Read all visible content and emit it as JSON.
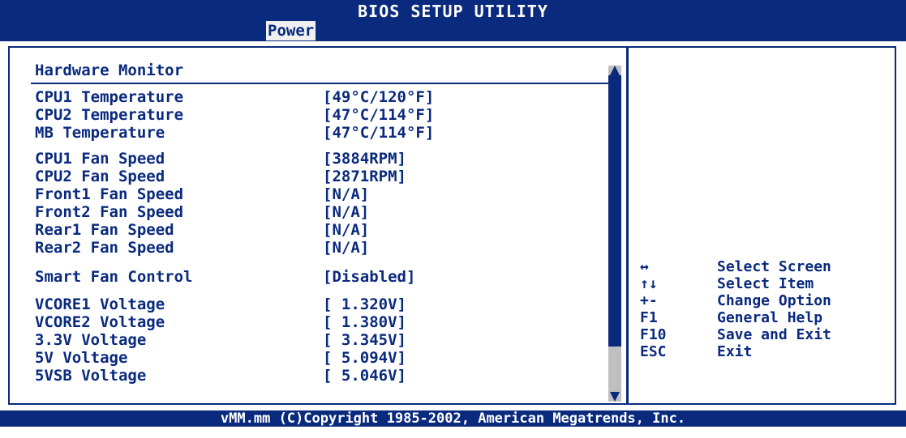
{
  "header": {
    "title": "BIOS SETUP UTILITY",
    "active_tab": "Power"
  },
  "section": {
    "title": "Hardware Monitor"
  },
  "rows": [
    {
      "label": "CPU1 Temperature",
      "value": "[49°C/120°F]"
    },
    {
      "label": "CPU2 Temperature",
      "value": "[47°C/114°F]"
    },
    {
      "label": "MB Temperature",
      "value": "[47°C/114°F]"
    },
    {
      "label": "CPU1 Fan Speed",
      "value": "[3884RPM]"
    },
    {
      "label": "CPU2 Fan Speed",
      "value": "[2871RPM]"
    },
    {
      "label": "Front1 Fan Speed",
      "value": "[N/A]"
    },
    {
      "label": "Front2 Fan Speed",
      "value": "[N/A]"
    },
    {
      "label": "Rear1 Fan Speed",
      "value": "[N/A]"
    },
    {
      "label": "Rear2 Fan Speed",
      "value": "[N/A]"
    },
    {
      "label": "Smart Fan Control",
      "value": "[Disabled]"
    },
    {
      "label": "VCORE1 Voltage",
      "value": "[ 1.320V]"
    },
    {
      "label": "VCORE2 Voltage",
      "value": "[ 1.380V]"
    },
    {
      "label": "3.3V Voltage",
      "value": "[ 3.345V]"
    },
    {
      "label": "5V Voltage",
      "value": "[ 5.094V]"
    },
    {
      "label": "5VSB Voltage",
      "value": "[ 5.046V]"
    }
  ],
  "help": [
    {
      "key": "↔",
      "desc": "Select Screen"
    },
    {
      "key": "↑↓",
      "desc": "Select Item"
    },
    {
      "key": "+-",
      "desc": "Change Option"
    },
    {
      "key": "F1",
      "desc": "General Help"
    },
    {
      "key": "F10",
      "desc": "Save and Exit"
    },
    {
      "key": "ESC",
      "desc": "Exit"
    }
  ],
  "footer": {
    "text": "vMM.mm (C)Copyright 1985-2002, American Megatrends, Inc."
  },
  "colors": {
    "primary": "#0a2a7e",
    "background": "#ffffff",
    "scroll_track": "#bfbfbf"
  },
  "icons": {
    "scroll_up": "up-triangle",
    "scroll_down": "down-triangle"
  }
}
